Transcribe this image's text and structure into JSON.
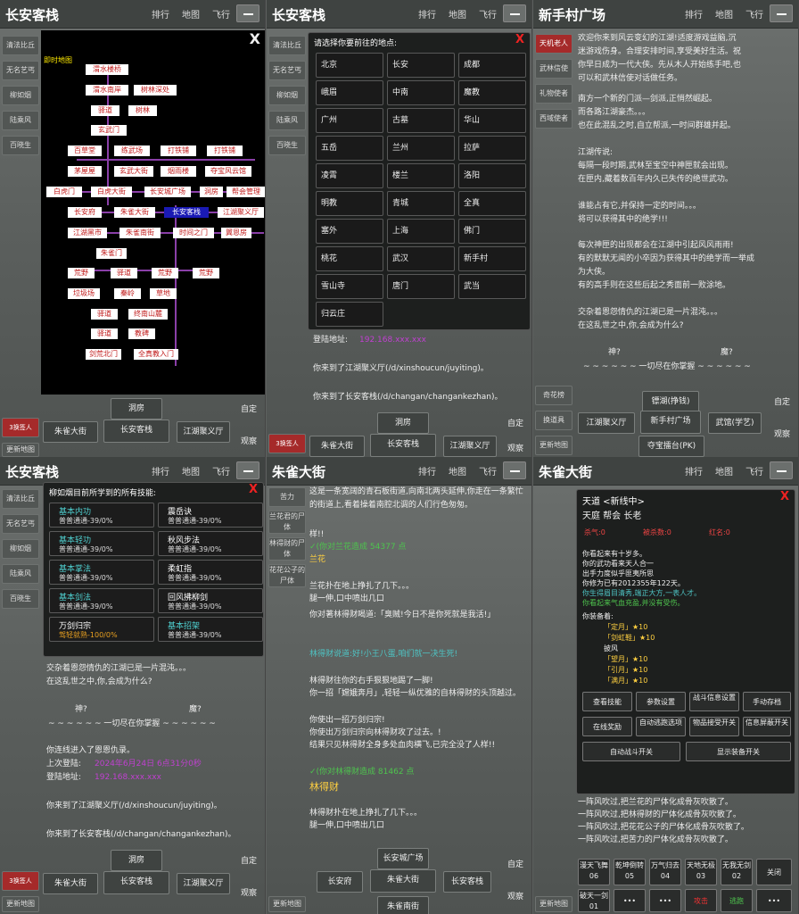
{
  "header_buttons": {
    "rank": "排行",
    "map": "地图",
    "fly": "飞行"
  },
  "sidebar_common": [
    "清法比丘",
    "无名艺丐",
    "柳如烟",
    "陆乘风",
    "百晓生"
  ],
  "sidebar_p3": [
    "天机老人",
    "武林信使",
    "礼物使者",
    "西域使者"
  ],
  "sidebar_p3_bottom": [
    "奇花榜",
    "换道具",
    "更新地图"
  ],
  "sidebar_p5": [
    "苦力",
    "兰花君的尸体",
    "林得财的尸体",
    "花花公子的尸体"
  ],
  "bottom_left": {
    "update_map": "更新地图",
    "active_tag": "3换签人"
  },
  "p1": {
    "title": "长安客栈",
    "close": "X",
    "map_label": "即时地图",
    "nav_top": "洞房",
    "nav_left": "朱雀大街",
    "nav_center": "长安客栈",
    "nav_right": "江湖聚义厅",
    "side_self": "自定",
    "side_watch": "观察"
  },
  "map_nodes": [
    "渭水楼桥",
    "渭水南岸",
    "树林深处",
    "驿道",
    "树林",
    "玄武门",
    "百草堂",
    "练武场",
    "打铁铺",
    "打铁铺",
    "茅屋屋",
    "玄武大街",
    "烟雨楼",
    "夺宝风云馆",
    "白虎门",
    "白虎大街",
    "长安城广场",
    "洞房",
    "帮会管理",
    "长安府",
    "朱雀大街",
    "长安客栈",
    "江湖聚义厅",
    "江湖黑市",
    "朱雀南街",
    "时间之门",
    "翼恩房",
    "朱雀门",
    "荒野",
    "驿道",
    "荒野",
    "荒野",
    "垃圾场",
    "秦岭",
    "草地",
    "驿道",
    "终南山麓",
    "驿道",
    "教碑",
    "剑荒北门",
    "全真教入门"
  ],
  "p2": {
    "title": "长安客栈",
    "dialog_head": "请选择你要前往的地点:",
    "close": "X",
    "places": [
      "北京",
      "长安",
      "成都",
      "峨眉",
      "中南",
      "魔教",
      "广州",
      "古墓",
      "华山",
      "五岳",
      "兰州",
      "拉萨",
      "凌霄",
      "楼兰",
      "洛阳",
      "明教",
      "青城",
      "全真",
      "塞外",
      "上海",
      "佛门",
      "桃花",
      "武汉",
      "新手村",
      "雪山寺",
      "唐门",
      "武当",
      "归云庄"
    ],
    "login_label": "登陆地址:",
    "login_value": "192.168.xxx.xxx",
    "msg1": "你来到了江湖聚义厅(/d/xinshoucun/juyiting)。",
    "msg2": "你来到了长安客栈(/d/changan/changankezhan)。",
    "nav_top": "洞房",
    "nav_left": "朱雀大街",
    "nav_center": "长安客栈",
    "nav_right": "江湖聚义厅",
    "side_self": "自定",
    "side_watch": "观察"
  },
  "p3": {
    "title": "新手村广场",
    "lines": [
      "欢迎你来到风云变幻的江湖!适度游戏益脑,沉",
      "迷游戏伤身。合理安排时间,享受美好生活。祝",
      "你早日成为一代大侠。先从木人开始练手吧,也",
      "可以和武林信使对话做任务。",
      "南方一个新的门派—剑派,正悄然崛起。",
      "而各路江湖豪杰。。。",
      "也在此混乱之时,自立帮派,一时间群雄并起。",
      "",
      "江湖传说:",
      "每隔一段时期,武林至宝空中神匣就会出现。",
      "在匣内,藏着数百年内久已失传的绝世武功。",
      "",
      "谁能占有它,并保持一定的时间。。。",
      "将可以获得其中的绝学!!!",
      "",
      "每次神匣的出现都会在江湖中引起风风雨雨!",
      "有的默默无闻的小卒因为获得其中的绝学而一举成",
      "为大侠。",
      "有的高手则在这些后起之秀面前一败涂地。",
      "",
      "交杂着恩怨情仇的江湖已是一片混沌。。。",
      "在这乱世之中,你,会成为什么?"
    ],
    "god": "神?",
    "demon": "魔?",
    "wave": "~ ~ ~ ~ ~ ~ 一切尽在你掌握 ~ ~ ~ ~ ~ ~",
    "nav_top": "镖湖(挣钱)",
    "nav_left": "江湖聚义厅",
    "nav_center": "新手村广场",
    "nav_right": "武馆(学艺)",
    "nav_bottom": "夺宝擂台(PK)",
    "side_self": "自定",
    "side_watch": "观察"
  },
  "p4": {
    "title": "长安客栈",
    "dialog_head": "柳如烟目前所学到的所有技能:",
    "close": "X",
    "skills": [
      {
        "name": "基本内功",
        "val": "普普通通-39/0%"
      },
      {
        "name": "震岳诀",
        "val": "普普通通-39/0%"
      },
      {
        "name": "基本轻功",
        "val": "普普通通-39/0%"
      },
      {
        "name": "秋风步法",
        "val": "普普通通-39/0%"
      },
      {
        "name": "基本掌法",
        "val": "普普通通-39/0%"
      },
      {
        "name": "柔虹指",
        "val": "普普通通-39/0%"
      },
      {
        "name": "基本剑法",
        "val": "普普通通-39/0%"
      },
      {
        "name": "回风拂柳剑",
        "val": "普普通通-39/0%"
      },
      {
        "name": "万剑归宗",
        "val": "驾轻就熟-100/0%"
      },
      {
        "name": "基本招架",
        "val": "普普通通-39/0%"
      }
    ],
    "lines": [
      "交杂着恩怨情仇的江湖已是一片混沌。。。",
      "在这乱世之中,你,会成为什么?"
    ],
    "god": "神?",
    "demon": "魔?",
    "wave": "~ ~ ~ ~ ~ ~ 一切尽在你掌握 ~ ~ ~ ~ ~ ~",
    "linked": "你连线进入了恩恩仇录。",
    "last_login_label": "上次登陆:",
    "last_login_value": "2024年6月24日 6点31分0秒",
    "login_label": "登陆地址:",
    "login_value": "192.168.xxx.xxx",
    "msg1": "你来到了江湖聚义厅(/d/xinshoucun/juyiting)。",
    "msg2": "你来到了长安客栈(/d/changan/changankezhan)。",
    "nav_top": "洞房",
    "nav_left": "朱雀大街",
    "nav_center": "长安客栈",
    "nav_right": "江湖聚义厅",
    "side_self": "自定",
    "side_watch": "观察"
  },
  "p5": {
    "title": "朱雀大街",
    "desc": "这是一条宽阔的青石板街道,向南北两头延伸,你走在一条繁忙的街道上,看着操着南腔北调的人们行色匆匆。",
    "lines": [
      "样!!",
      "✓(你对兰花造成 54377 点",
      "兰花",
      "兰花扑在地上挣扎了几下。。。",
      "腿一伸,口中喷出几口",
      "你对著林得财喝道:「臭贼!今日不是你死就是我活!」",
      "林得财说道:好!小王八蛋,咱们就一决生死!",
      "",
      "林得财往你的右手狠狠地踢了一脚!",
      "你一招「嫦娥奔月」,轻轻一纵优雅的自林得财的头顶越过。",
      "你使出一招万剑归宗!",
      "你使出万剑归宗向林得财攻了过去。!",
      "结果只见林得财全身多处血肉横飞,已完全没了人样!!",
      "✓(你对林得财造成 81462 点",
      "林得财",
      "林得财扑在地上挣扎了几下。。。",
      "腿一伸,口中喷出几口"
    ],
    "nav_top": "长安城广场",
    "nav_left": "长安府",
    "nav_center": "朱雀大街",
    "nav_right": "长安客栈",
    "nav_bottom": "朱雀南街",
    "side_self": "自定",
    "side_watch": "观察"
  },
  "p6": {
    "title": "朱雀大街",
    "dialog_title": "天道 <新线中>",
    "close": "X",
    "rank": "天庭 帮会 长老",
    "kills_label": "杀气:0",
    "killed_label": "被杀数:0",
    "red_label": "红名:0",
    "info": [
      "你看起来有十岁多。",
      "你的武功看来天人合一",
      "出手力度似乎匪夷所思",
      "你修为已有2012355年122天。",
      "你生得眉目清秀,端正大方,一表人才。",
      "你看起来气血充盈,并没有受伤。",
      "你装备着:"
    ],
    "equip": [
      "「定月」★10",
      "「剑虹鞋」★10",
      "披风",
      "「望月」★10",
      "「引月」★10",
      "「满月」★10"
    ],
    "buttons": [
      "查看技能",
      "参数设置",
      "战斗信息设置",
      "手动存档",
      "在线奖励",
      "自动逃跑选项",
      "物品接受开关",
      "信息屏蔽开关",
      "自动战斗开关",
      "显示装备开关"
    ],
    "msgs": [
      "一阵风吹过,把兰花的尸体化成骨灰吹散了。",
      "一阵风吹过,把林得财的尸体化成骨灰吹散了。",
      "一阵风吹过,把花花公子的尸体化成骨灰吹散了。",
      "一阵风吹过,把苦力的尸体化成骨灰吹散了。"
    ],
    "skill_bar": [
      "漫天飞舞06",
      "乾坤倒转05",
      "万气归去04",
      "天地无极03",
      "无我无剑02",
      "关闭"
    ],
    "bottom_bar": [
      "破天一剑01",
      "•••",
      "•••",
      "攻击",
      "逃跑",
      "•••"
    ]
  }
}
